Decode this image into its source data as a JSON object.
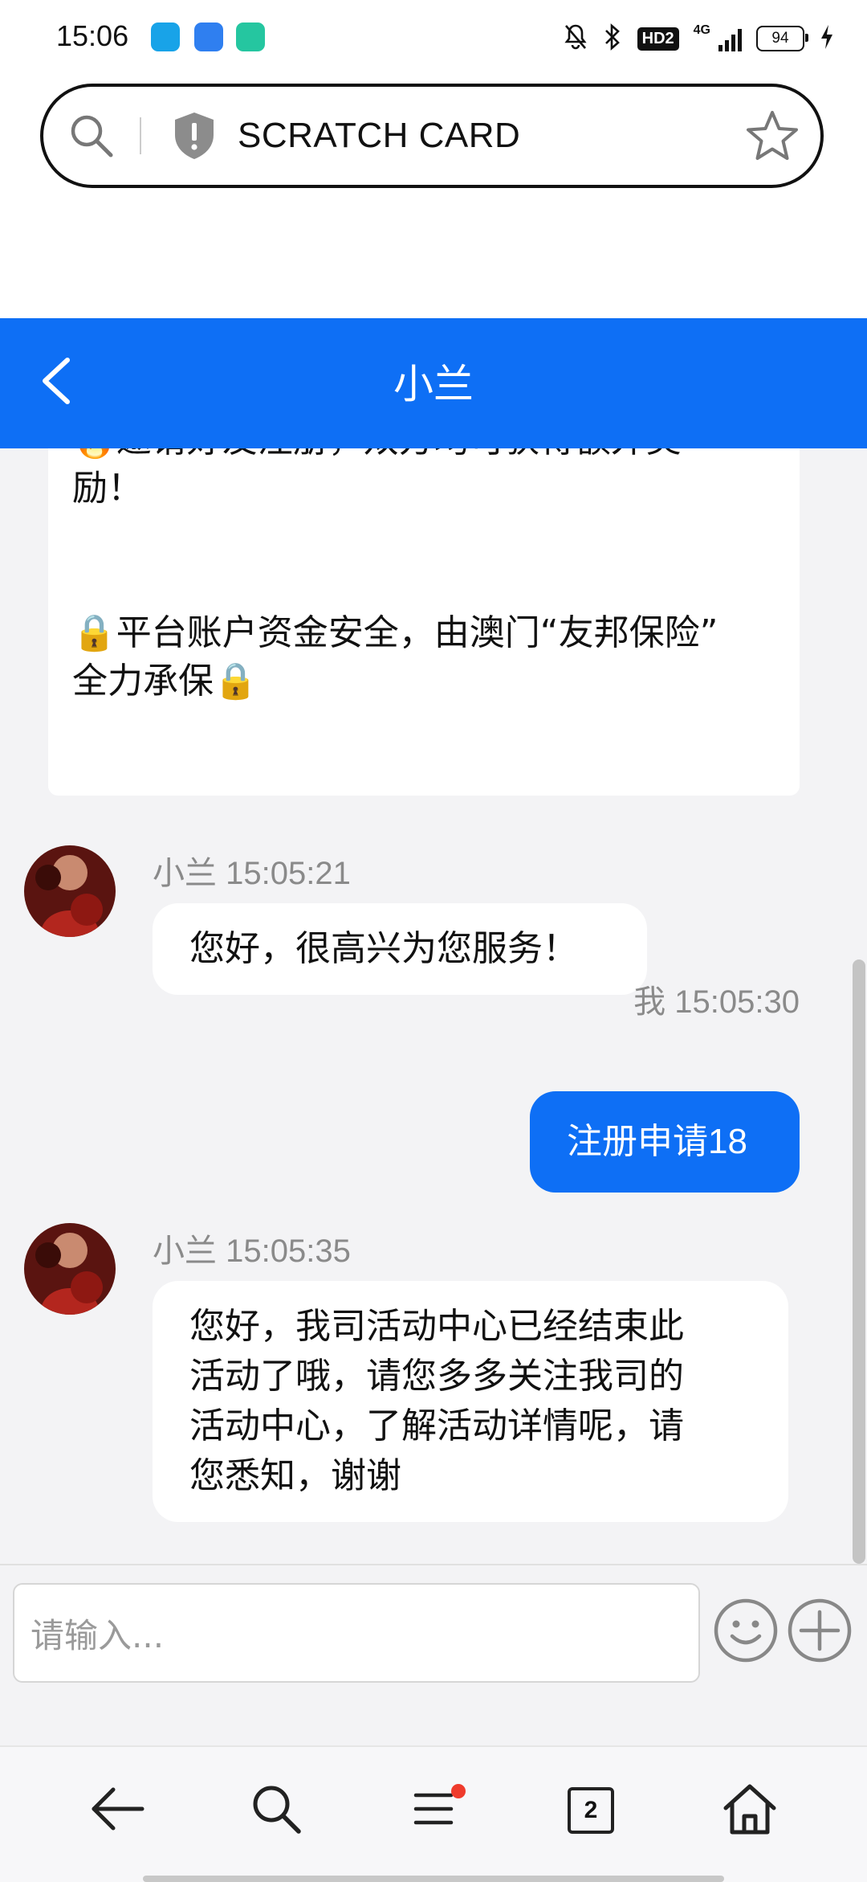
{
  "status_bar": {
    "time": "15:06",
    "network": "4G",
    "hd_label": "HD2",
    "battery": "94",
    "icons": [
      "mute-bell-icon",
      "bluetooth-icon",
      "signal-icon",
      "charging-icon"
    ]
  },
  "browser": {
    "url_title": "SCRATCH CARD",
    "icons": [
      "search-icon",
      "shield-icon",
      "star-icon"
    ]
  },
  "chat": {
    "title": "小兰",
    "info_card": {
      "lines": [
        "🔥邀请好友注册，双方均可获得额外奖",
        "励！",
        "🔒平台账户资金安全，由澳门“友邦保险”",
        "全力承保🔒"
      ]
    },
    "messages": [
      {
        "side": "left",
        "sender": "小兰",
        "time": "15:05:21",
        "meta": "小兰 15:05:21",
        "lines": [
          "您好，很高兴为您服务！"
        ]
      },
      {
        "side": "right",
        "sender": "我",
        "time": "15:05:30",
        "meta": "我 15:05:30",
        "lines": [
          "注册申请18"
        ]
      },
      {
        "side": "left",
        "sender": "小兰",
        "time": "15:05:35",
        "meta": "小兰 15:05:35",
        "lines": [
          "您好，我司活动中心已经结束此",
          "活动了哦，请您多多关注我司的",
          "活动中心，了解活动详情呢，请",
          "您悉知，谢谢"
        ]
      }
    ]
  },
  "input": {
    "placeholder": "请输入..."
  },
  "bottom_nav": {
    "tab_count": "2",
    "items": [
      "back-icon",
      "search-icon",
      "menu-icon",
      "tabs-icon",
      "home-icon"
    ]
  },
  "colors": {
    "accent": "#0e6ff5",
    "background": "#f3f3f5",
    "notification_dot": "#ef3b2c"
  }
}
